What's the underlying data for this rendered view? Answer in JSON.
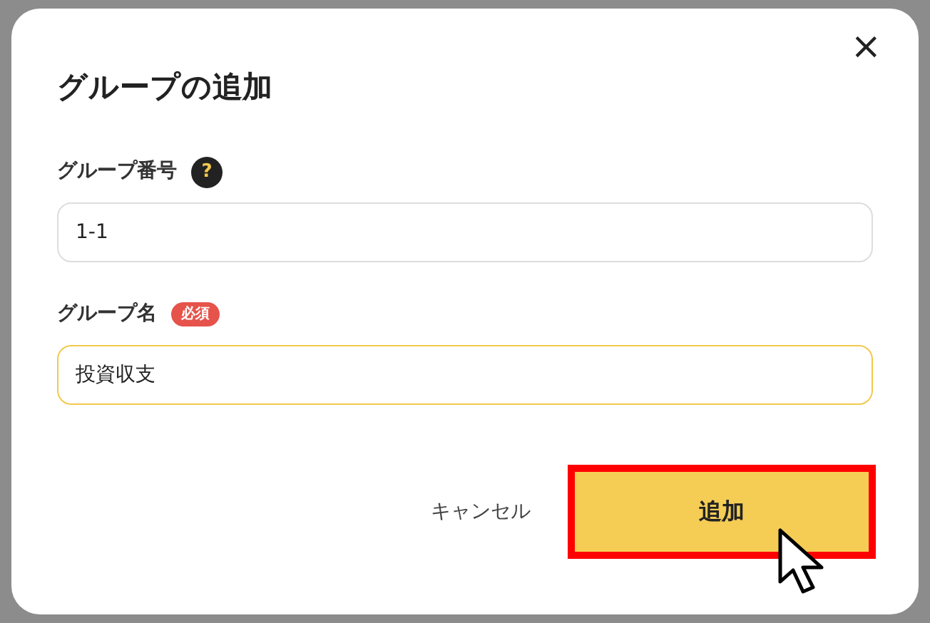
{
  "dialog": {
    "title": "グループの追加",
    "close": "×"
  },
  "fields": [
    {
      "label": "グループ番号",
      "help": "?",
      "value": "1-1",
      "focused": false
    },
    {
      "label": "グループ名",
      "value": "投資収支",
      "required": "必須",
      "focused": true
    }
  ],
  "buttons": [
    {
      "label": "キャンセル",
      "kind": "text",
      "highlighted": false
    },
    {
      "label": "追加",
      "kind": "primary",
      "highlighted": true
    }
  ]
}
